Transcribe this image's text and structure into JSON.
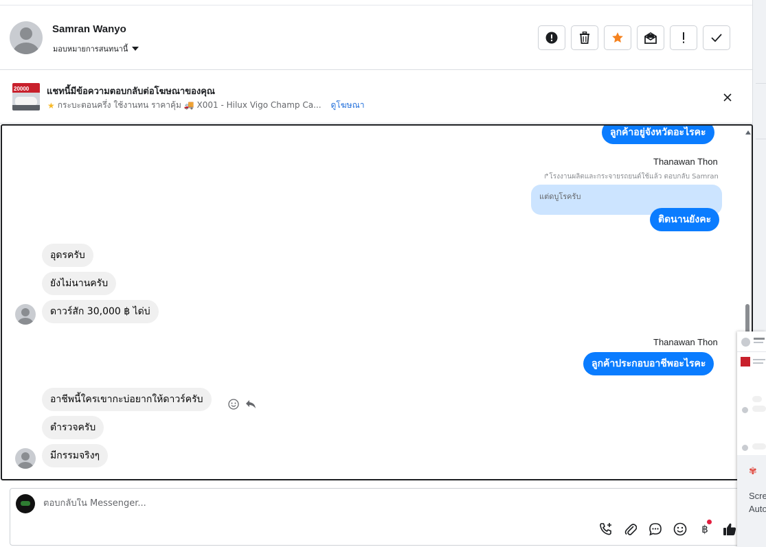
{
  "header": {
    "contact_name": "Samran Wanyo",
    "assign_label": "มอบหมายการสนทนานี้",
    "actions": [
      {
        "icon": "alert-circle-icon"
      },
      {
        "icon": "trash-icon"
      },
      {
        "icon": "star-icon",
        "color": "#f5821f"
      },
      {
        "icon": "mark-unread-icon"
      },
      {
        "icon": "exclamation-icon"
      },
      {
        "icon": "check-icon"
      }
    ]
  },
  "ad_banner": {
    "title": "แชทนี้มีข้อความตอบกลับต่อโฆษณาของคุณ",
    "description": "กระบะตอนครึ่ง ใช้งานทน ราคาคุ้ม 🚚 X001 - Hilux Vigo Champ Ca...",
    "link": "ดูโฆษณา",
    "thumb_badge": "20000"
  },
  "messages": {
    "out_1": "ลูกค้าอยู่จังหวัดอะไรคะ",
    "sender_1": "Thanawan Thon",
    "reply_note": "↱โรงงานผลิตและกระจายรถยนต์ใช้แล้ว ตอบกลับ Samran",
    "quoted": "แต่ดบูโรครับ",
    "out_2": "ติดนานยังคะ",
    "in_1": "อุดรครับ",
    "in_2": "ยังไม่นานครับ",
    "in_3": "ดาวร์สัก 30,000 ฿ ได่บ่",
    "sender_2": "Thanawan Thon",
    "out_3": "ลูกค้าประกอบอาชีพอะไรคะ",
    "in_4": "อาชีพนี้ใครเขากะบ่อยากให้ดาวร์ครับ",
    "in_5": "ตำรวจครับ",
    "in_6": "มีกรรมจริงๆ"
  },
  "composer": {
    "placeholder": "ตอบกลับใน Messenger...",
    "tools": [
      "phone-plus-icon",
      "attachment-icon",
      "chat-bubble-icon",
      "emoji-icon",
      "baht-icon",
      "like-icon"
    ]
  },
  "overlay_preview": {
    "line1": "Scre",
    "line2": "Auto"
  },
  "colors": {
    "outgoing_bubble": "#0a7cff",
    "incoming_bubble": "#f0f0f0",
    "quoted_bubble": "#cce4ff",
    "star": "#f5821f",
    "link": "#216fdb"
  }
}
